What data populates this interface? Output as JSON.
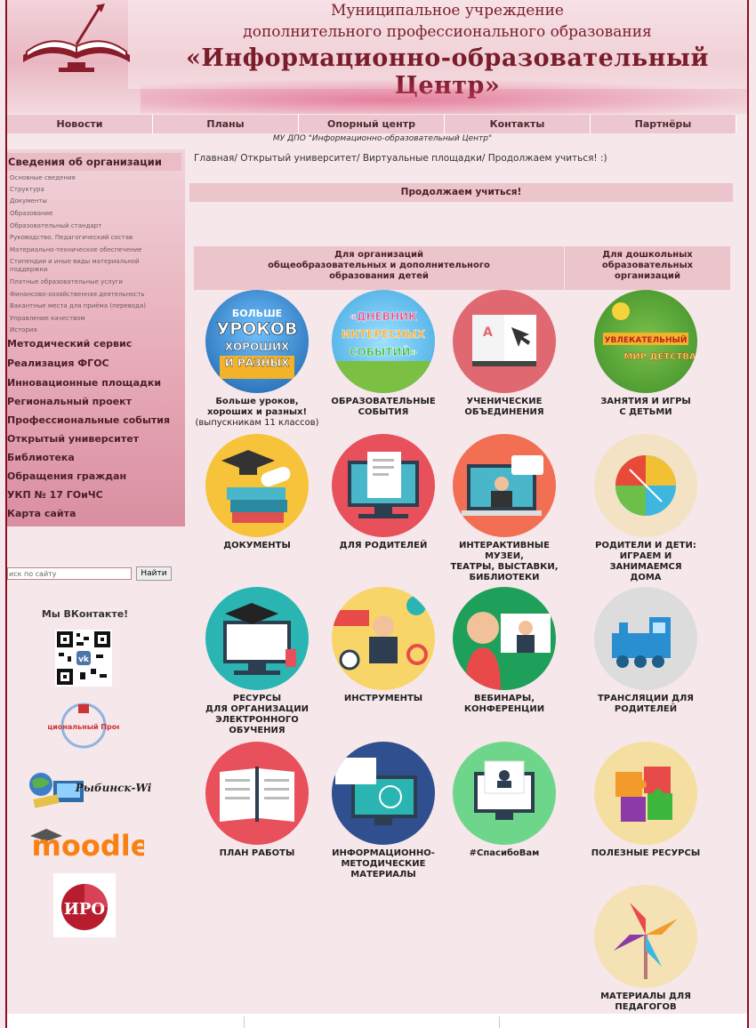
{
  "header": {
    "line1": "Муниципальное учреждение",
    "line2": "дополнительного профессионального образования",
    "line3": "«Информационно-образовательный Центр»"
  },
  "nav": [
    "Новости",
    "Планы",
    "Опорный центр",
    "Контакты",
    "Партнёры"
  ],
  "tagline": "МУ ДПО \"Информационно-образовательный Центр\"",
  "sidebar": {
    "head": "Сведения об организации",
    "sub": [
      "Основные сведения",
      "Структура",
      "Документы",
      "Образование",
      "Образовательный стандарт",
      "Руководство. Педагогический состав",
      "Материально-техническое обеспечение",
      "Стипендии и иные виды материальной",
      "поддержки",
      "Платные образовательные услуги",
      "Финансово-хозяйственная деятельность",
      "Вакантные места для приёма (перевода)",
      "Управление качеством",
      "История"
    ],
    "main": [
      "Методический сервис",
      "Реализация ФГОС",
      "Инновационные площадки",
      "Региональный проект",
      "Профессиональные события",
      "Открытый университет",
      "Библиотека",
      "Обращения граждан",
      "УКП № 17 ГОиЧС",
      "Карта сайта"
    ]
  },
  "search": {
    "placeholder": "иск по сайту",
    "button": "Найти"
  },
  "vk": {
    "title": "Мы ВКонтакте!"
  },
  "logos": {
    "pr": "Национальный Проект",
    "wiki": "Рыбинск-Wiki",
    "moodle": "moodle",
    "iro": "ИРО"
  },
  "breadcrumb": "Главная/ Открытый университет/ Виртуальные площадки/ Продолжаем учиться! :)",
  "page_title": "Продолжаем учиться!",
  "col_heads": {
    "left": "Для организаций\nобщеобразовательных и дополнительного\nобразования детей",
    "right": "Для дошкольных\nобразовательных\nорганизаций"
  },
  "tiles": {
    "t1": {
      "label": "Больше уроков,\nхороших и разных!",
      "sub": "(выпускникам 11 классов)",
      "art1": "БОЛЬШЕ",
      "art2": "УРОКОВ",
      "art3": "ХОРОШИХ",
      "art4": "И РАЗНЫХ"
    },
    "t2": {
      "label": "ОБРАЗОВАТЕЛЬНЫЕ\nСОБЫТИЯ",
      "art1": "«ДНЕВНИК",
      "art2": "ИНТЕРЕСНЫХ",
      "art3": "СОБЫТИЙ»"
    },
    "t3": {
      "label": "УЧЕНИЧЕСКИЕ\nОБЪЕДИНЕНИЯ"
    },
    "t4": {
      "label": "ЗАНЯТИЯ И ИГРЫ\nС ДЕТЬМИ",
      "art1": "УВЛЕКАТЕЛЬНЫЙ",
      "art2": "МИР ДЕТСТВА"
    },
    "t5": {
      "label": "ДОКУМЕНТЫ"
    },
    "t6": {
      "label": "ДЛЯ РОДИТЕЛЕЙ"
    },
    "t7": {
      "label": "ИНТЕРАКТИВНЫЕ\nМУЗЕИ,\nТЕАТРЫ, ВЫСТАВКИ,\nБИБЛИОТЕКИ"
    },
    "t8": {
      "label": "РОДИТЕЛИ И ДЕТИ:\nИГРАЕМ И ЗАНИМАЕМСЯ\nДОМА"
    },
    "t9": {
      "label": "РЕСУРСЫ\nДЛЯ ОРГАНИЗАЦИИ\nЭЛЕКТРОННОГО\nОБУЧЕНИЯ"
    },
    "t10": {
      "label": "ИНСТРУМЕНТЫ"
    },
    "t11": {
      "label": "ВЕБИНАРЫ,\nКОНФЕРЕНЦИИ"
    },
    "t12": {
      "label": "ТРАНСЛЯЦИИ ДЛЯ\nРОДИТЕЛЕЙ"
    },
    "t13": {
      "label": "ПЛАН РАБОТЫ"
    },
    "t14": {
      "label": "ИНФОРМАЦИОННО-\nМЕТОДИЧЕСКИЕ\nМАТЕРИАЛЫ"
    },
    "t15": {
      "label": "#СпасибоВам"
    },
    "t16": {
      "label": "ПОЛЕЗНЫЕ РЕСУРСЫ"
    },
    "t17": {
      "label": "МАТЕРИАЛЫ ДЛЯ ПЕДАГОГОВ\nДОО"
    }
  }
}
